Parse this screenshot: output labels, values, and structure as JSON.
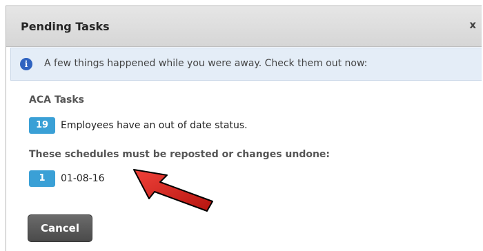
{
  "dialog": {
    "title": "Pending Tasks",
    "close_label": "x"
  },
  "info": {
    "icon": "info-icon",
    "icon_glyph": "i",
    "message": "A few things happened while you were away. Check them out now:"
  },
  "aca": {
    "heading": "ACA Tasks",
    "count": "19",
    "text": "Employees have an out of date status."
  },
  "schedules": {
    "heading": "These schedules must be reposted or changes undone:",
    "count": "1",
    "text": "01-08-16"
  },
  "actions": {
    "cancel_label": "Cancel"
  },
  "colors": {
    "badge": "#3aa0d6",
    "info_bar": "#e4edf7",
    "arrow": "#d8231f"
  }
}
